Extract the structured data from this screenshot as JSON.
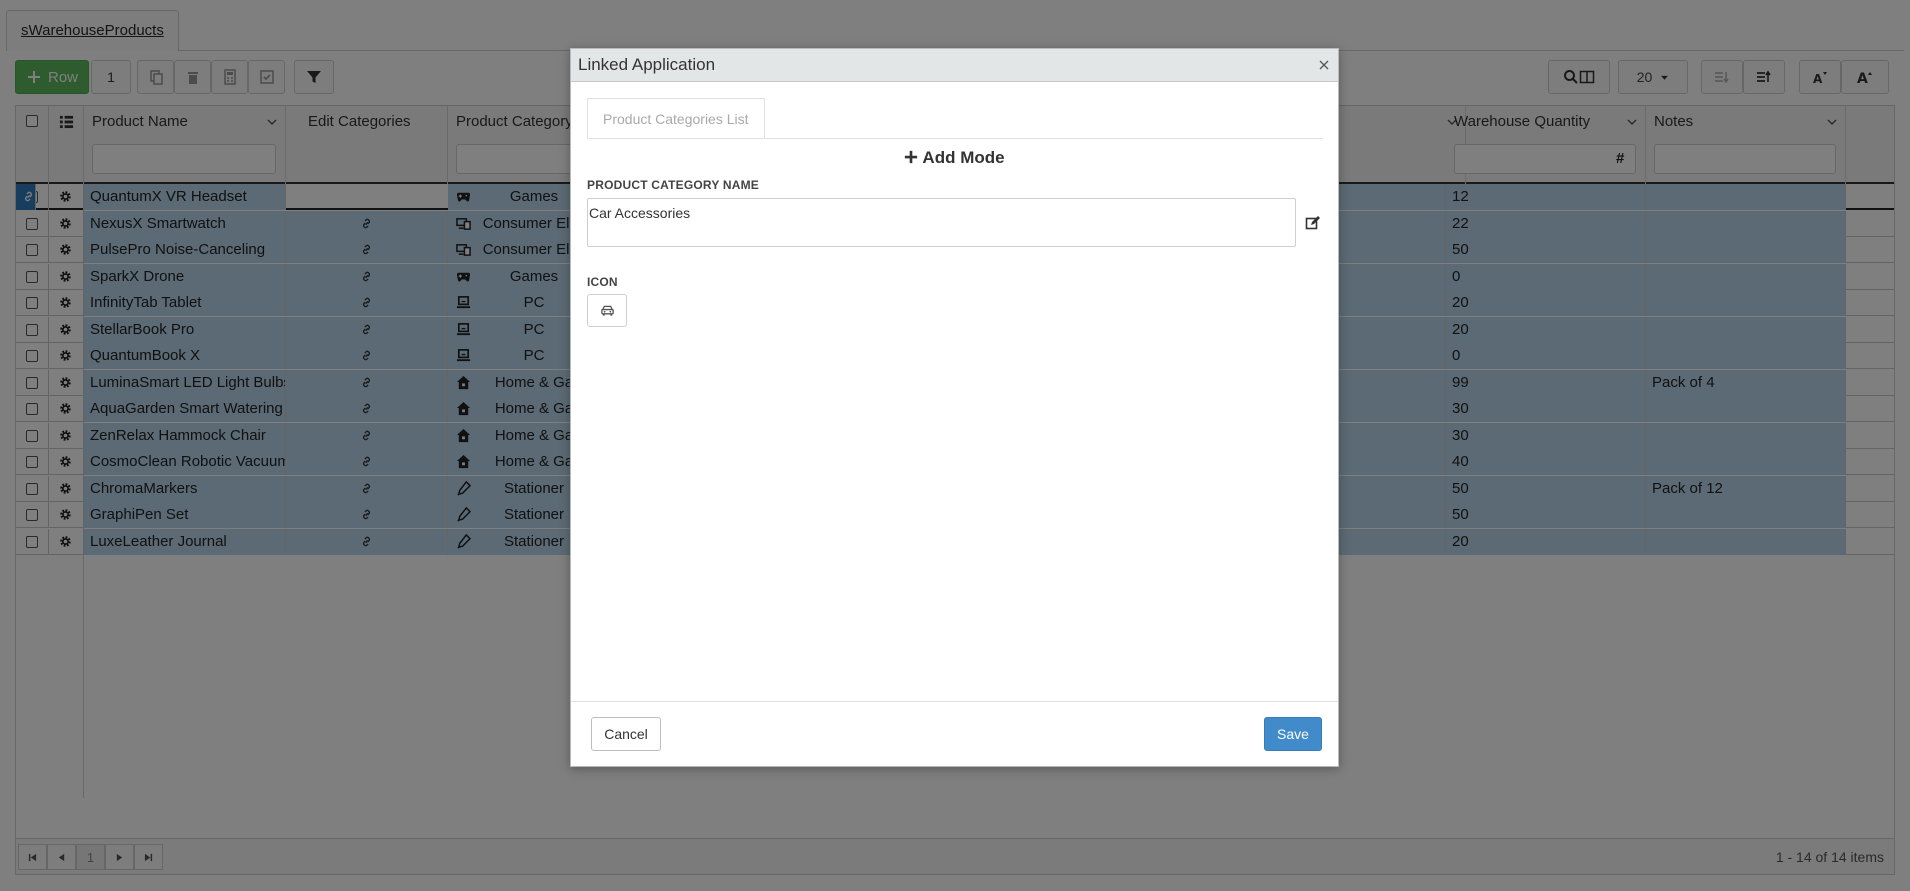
{
  "app_tab": "sWarehouseProducts",
  "toolbar": {
    "add_row_label": "Row",
    "selected_count": "1",
    "page_size": "20"
  },
  "grid": {
    "columns": [
      "Product Name",
      "Edit Categories",
      "Product Category",
      "Warehouse Quantity",
      "Notes"
    ],
    "rows": [
      {
        "name": "QuantumX VR Headset",
        "category": "Games",
        "category_icon": "gamepad-icon",
        "quantity": "12",
        "notes": ""
      },
      {
        "name": "NexusX Smartwatch",
        "category": "Consumer Elec",
        "category_icon": "devices-icon",
        "quantity": "22",
        "notes": ""
      },
      {
        "name": "PulsePro Noise-Canceling",
        "category": "Consumer Elec",
        "category_icon": "devices-icon",
        "quantity": "50",
        "notes": ""
      },
      {
        "name": "SparkX Drone",
        "category": "Games",
        "category_icon": "gamepad-icon",
        "quantity": "0",
        "notes": ""
      },
      {
        "name": "InfinityTab Tablet",
        "category": "PC",
        "category_icon": "laptop-icon",
        "quantity": "20",
        "notes": ""
      },
      {
        "name": "StellarBook Pro",
        "category": "PC",
        "category_icon": "laptop-icon",
        "quantity": "20",
        "notes": ""
      },
      {
        "name": "QuantumBook X",
        "category": "PC",
        "category_icon": "laptop-icon",
        "quantity": "0",
        "notes": ""
      },
      {
        "name": "LuminaSmart LED Light Bulbs",
        "category": "Home & Ga",
        "category_icon": "home-icon",
        "quantity": "99",
        "notes": "Pack of 4"
      },
      {
        "name": "AquaGarden Smart Watering",
        "category": "Home & Ga",
        "category_icon": "home-icon",
        "quantity": "30",
        "notes": ""
      },
      {
        "name": "ZenRelax Hammock Chair",
        "category": "Home & Ga",
        "category_icon": "home-icon",
        "quantity": "30",
        "notes": ""
      },
      {
        "name": "CosmoClean Robotic Vacuum",
        "category": "Home & Ga",
        "category_icon": "home-icon",
        "quantity": "40",
        "notes": ""
      },
      {
        "name": "ChromaMarkers",
        "category": "Stationer",
        "category_icon": "pen-icon",
        "quantity": "50",
        "notes": "Pack of 12"
      },
      {
        "name": "GraphiPen Set",
        "category": "Stationer",
        "category_icon": "pen-icon",
        "quantity": "50",
        "notes": ""
      },
      {
        "name": "LuxeLeather Journal",
        "category": "Stationer",
        "category_icon": "pen-icon",
        "quantity": "20",
        "notes": ""
      }
    ]
  },
  "pager": {
    "current_page": "1",
    "info": "1 - 14 of 14 items"
  },
  "modal": {
    "title": "Linked Application",
    "tab_label": "Product Categories List",
    "mode_label": "Add Mode",
    "name_label": "PRODUCT CATEGORY NAME",
    "name_value": "Car Accessories",
    "icon_label": "ICON",
    "icon_name": "car-icon",
    "cancel_label": "Cancel",
    "save_label": "Save"
  },
  "colors": {
    "row_highlight": "#b7d4e8",
    "selected_cell": "#2f7bbf",
    "add_button": "#5cb85c",
    "save_button": "#428bca"
  }
}
